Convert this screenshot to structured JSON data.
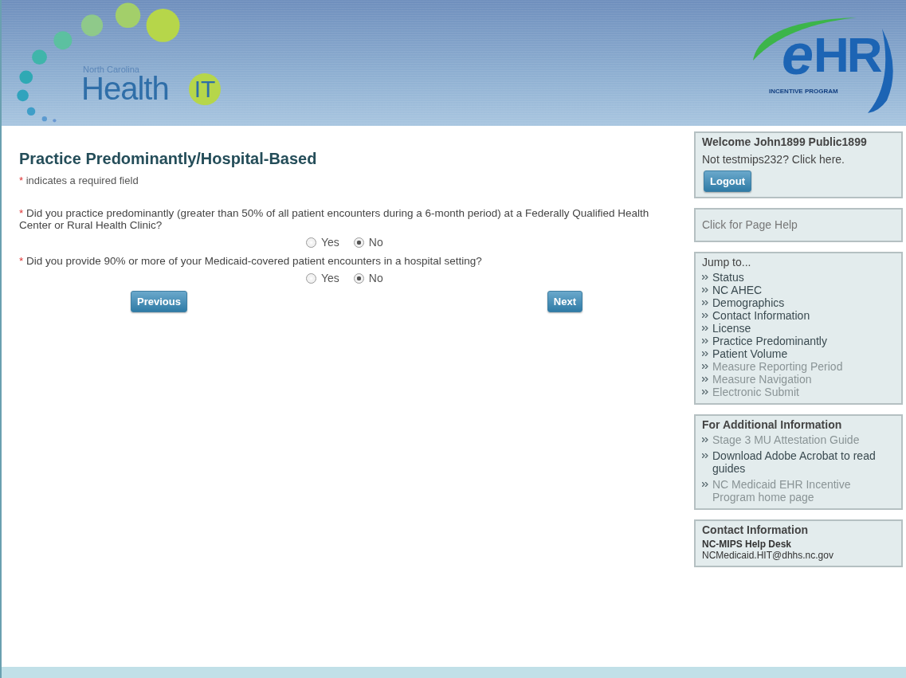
{
  "header": {
    "left_logo": {
      "region": "North Carolina",
      "name": "Health",
      "badge": "IT"
    },
    "right_logo": {
      "mark_e": "e",
      "mark": "HR",
      "caption": "INCENTIVE PROGRAM"
    }
  },
  "form": {
    "title": "Practice Predominantly/Hospital-Based",
    "required_mark": "*",
    "required_note": "indicates a required field",
    "questions": [
      {
        "text": "Did you practice predominantly (greater than 50% of all patient encounters during a 6-month period) at a Federally Qualified Health Center or Rural Health Clinic?",
        "options": [
          {
            "label": "Yes",
            "selected": false
          },
          {
            "label": "No",
            "selected": true
          }
        ]
      },
      {
        "text": "Did you provide 90% or more of your Medicaid-covered patient encounters in a hospital setting?",
        "options": [
          {
            "label": "Yes",
            "selected": false
          },
          {
            "label": "No",
            "selected": true
          }
        ]
      }
    ],
    "buttons": {
      "previous": "Previous",
      "next": "Next"
    }
  },
  "sidebar": {
    "welcome": {
      "title": "Welcome John1899 Public1899",
      "switch_link": "Not testmips232? Click here.",
      "logout": "Logout"
    },
    "help": "Click for Page Help",
    "jump": {
      "title": "Jump to...",
      "items": [
        {
          "label": "Status",
          "disabled": false
        },
        {
          "label": "NC AHEC",
          "disabled": false
        },
        {
          "label": "Demographics",
          "disabled": false
        },
        {
          "label": "Contact Information",
          "disabled": false
        },
        {
          "label": "License",
          "disabled": false
        },
        {
          "label": "Practice Predominantly",
          "disabled": false
        },
        {
          "label": "Patient Volume",
          "disabled": false
        },
        {
          "label": "Measure Reporting Period",
          "disabled": true
        },
        {
          "label": "Measure Navigation",
          "disabled": true
        },
        {
          "label": "Electronic Submit",
          "disabled": true
        }
      ]
    },
    "additional": {
      "title": "For Additional Information",
      "items": [
        {
          "label": "Stage 3 MU Attestation Guide",
          "disabled": true
        },
        {
          "label": "Download Adobe Acrobat to read guides",
          "disabled": false
        },
        {
          "label": "NC Medicaid EHR Incentive Program home page",
          "disabled": true
        }
      ]
    },
    "contact": {
      "title": "Contact Information",
      "name": "NC-MIPS Help Desk",
      "email": "NCMedicaid.HIT@dhhs.nc.gov"
    }
  }
}
